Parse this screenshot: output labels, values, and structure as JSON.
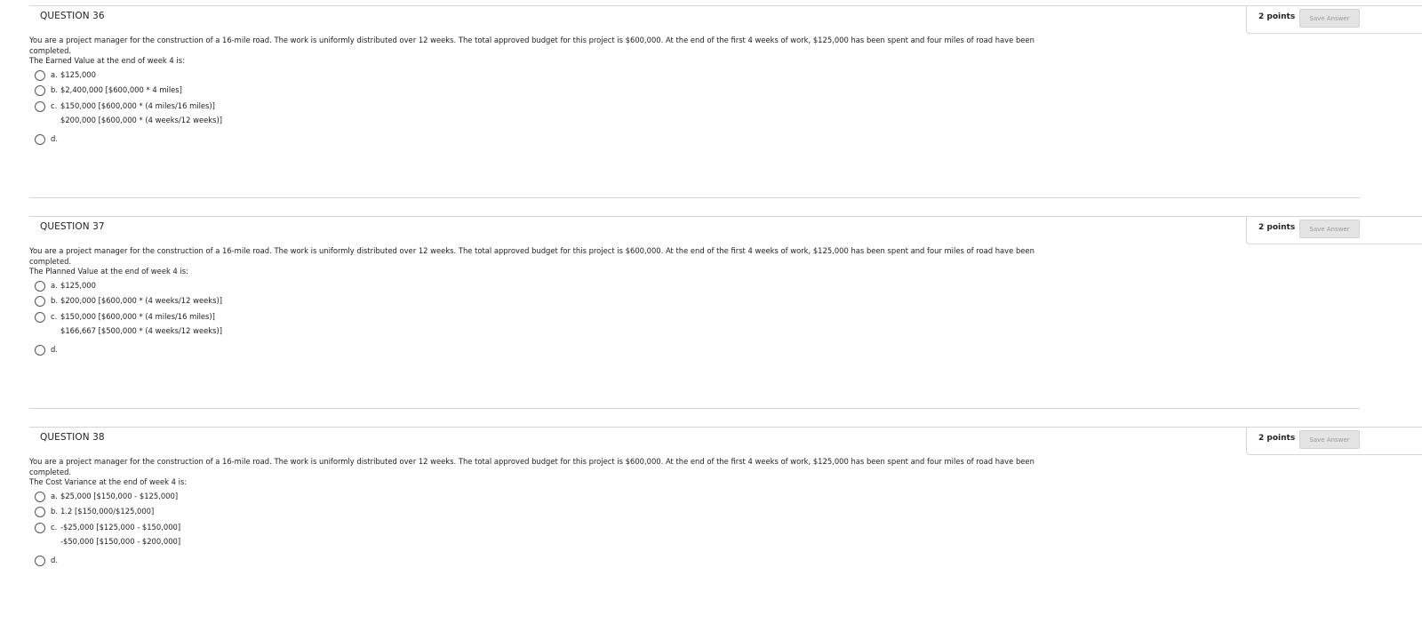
{
  "questions": [
    {
      "title": "QUESTION 36",
      "points": "2 points",
      "save_label": "Save Answer",
      "stem": "You are a project manager for the construction of a 16-mile road. The work is uniformly distributed over 12 weeks. The total approved budget for this project is $600,000. At the end of the first 4 weeks of work, $125,000 has been spent and four miles of road have been completed.",
      "prompt": "The Earned Value at the end of week 4 is:",
      "choices": [
        {
          "letter": "a.",
          "text": "$125,000"
        },
        {
          "letter": "b.",
          "text": "$2,400,000 [$600,000 * 4 miles]"
        },
        {
          "letter": "c.",
          "text": "$150,000 [$600,000 * (4 miles/16 miles)]"
        },
        {
          "letter": "d.",
          "text": ""
        }
      ],
      "extra_text": "$200,000 [$600,000 * (4 weeks/12 weeks)]"
    },
    {
      "title": "QUESTION 37",
      "points": "2 points",
      "save_label": "Save Answer",
      "stem": "You are a project manager for the construction of a 16-mile road. The work is uniformly distributed over 12 weeks. The total approved budget for this project is $600,000. At the end of the first 4 weeks of work, $125,000 has been spent and four miles of road have been completed.",
      "prompt": "The Planned Value at the end of week 4 is:",
      "choices": [
        {
          "letter": "a.",
          "text": "$125,000"
        },
        {
          "letter": "b.",
          "text": "$200,000 [$600,000 * (4 weeks/12 weeks)]"
        },
        {
          "letter": "c.",
          "text": "$150,000 [$600,000 * (4 miles/16 miles)]"
        },
        {
          "letter": "d.",
          "text": ""
        }
      ],
      "extra_text": "$166,667 [$500,000 * (4 weeks/12 weeks)]"
    },
    {
      "title": "QUESTION 38",
      "points": "2 points",
      "save_label": "Save Answer",
      "stem": "You are a project manager for the construction of a 16-mile road. The work is uniformly distributed over 12 weeks. The total approved budget for this project is $600,000. At the end of the first 4 weeks of work, $125,000 has been spent and four miles of road have been completed.",
      "prompt": "The Cost Variance at the end of week 4 is:",
      "choices": [
        {
          "letter": "a.",
          "text": "$25,000 [$150,000 - $125,000]"
        },
        {
          "letter": "b.",
          "text": "1.2 [$150,000/$125,000]"
        },
        {
          "letter": "c.",
          "text": "-$25,000 [$125,000 - $150,000]"
        },
        {
          "letter": "d.",
          "text": ""
        }
      ],
      "extra_text": "-$50,000 [$150,000 - $200,000]"
    }
  ]
}
